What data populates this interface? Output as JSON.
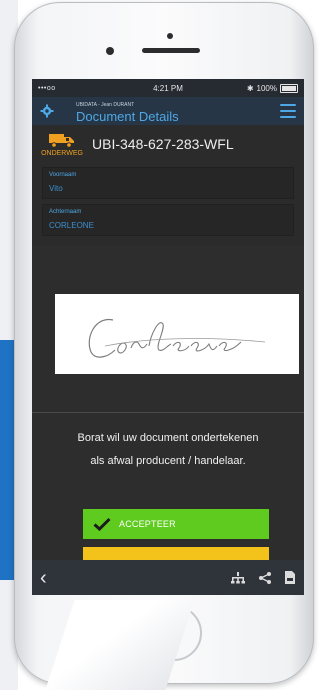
{
  "status": {
    "carrier": "•••oo",
    "time": "4:21 PM",
    "bluetooth": "✱",
    "battery_percent": "100%"
  },
  "nav": {
    "subtitle": "UBIDATA - Jean DURANT",
    "title": "Document Details"
  },
  "document": {
    "status_label": "ONDERWEG",
    "id": "UBI-348-627-283-WFL",
    "status_color": "#f0a020"
  },
  "fields": [
    {
      "label": "Voornaam",
      "value": "Vito"
    },
    {
      "label": "Achternaam",
      "value": "CORLEONE"
    }
  ],
  "message": {
    "line1": "Borat wil uw document ondertekenen",
    "line2": "als afwal producent / handelaar."
  },
  "buttons": {
    "accept_label": "ACCEPTEER",
    "accept_color": "#5fcb1f",
    "secondary_color": "#f3c21b"
  },
  "icons": {
    "settings": "gear-icon",
    "menu": "hamburger-icon",
    "truck": "truck-icon",
    "back": "chevron-left-icon",
    "network": "network-icon",
    "share": "share-icon",
    "pdf": "pdf-icon"
  }
}
